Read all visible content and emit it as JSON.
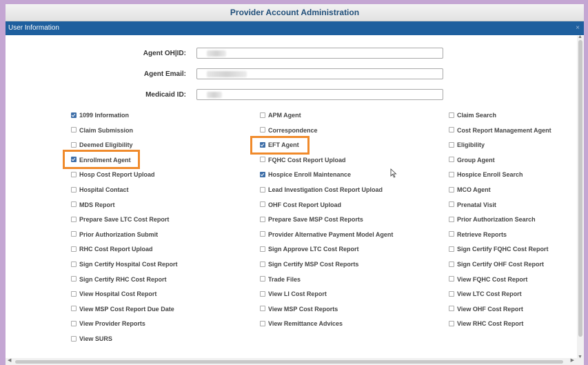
{
  "window": {
    "title": "Provider Account Administration"
  },
  "panel": {
    "title": "User Information",
    "close_glyph": "×"
  },
  "fields": [
    {
      "label": "Agent OH|ID:"
    },
    {
      "label": "Agent Email:"
    },
    {
      "label": "Medicaid ID:"
    }
  ],
  "permissions": {
    "col1": [
      {
        "label": "1099 Information",
        "checked": true
      },
      {
        "label": "Claim Submission",
        "checked": false
      },
      {
        "label": "Deemed Eligibility",
        "checked": false
      },
      {
        "label": "Enrollment Agent",
        "checked": true
      },
      {
        "label": "Hosp Cost Report Upload",
        "checked": false
      },
      {
        "label": "Hospital Contact",
        "checked": false
      },
      {
        "label": "MDS Report",
        "checked": false
      },
      {
        "label": "Prepare Save LTC Cost Report",
        "checked": false
      },
      {
        "label": "Prior Authorization Submit",
        "checked": false
      },
      {
        "label": "RHC Cost Report Upload",
        "checked": false
      },
      {
        "label": "Sign Certify Hospital Cost Report",
        "checked": false
      },
      {
        "label": "Sign Certify RHC Cost Report",
        "checked": false
      },
      {
        "label": "View Hospital Cost Report",
        "checked": false
      },
      {
        "label": "View MSP Cost Report Due Date",
        "checked": false
      },
      {
        "label": "View Provider Reports",
        "checked": false
      },
      {
        "label": "View SURS",
        "checked": false
      }
    ],
    "col2": [
      {
        "label": "APM Agent",
        "checked": false
      },
      {
        "label": "Correspondence",
        "checked": false
      },
      {
        "label": "EFT Agent",
        "checked": true
      },
      {
        "label": "FQHC Cost Report Upload",
        "checked": false
      },
      {
        "label": "Hospice Enroll Maintenance",
        "checked": true
      },
      {
        "label": "Lead Investigation Cost Report Upload",
        "checked": false
      },
      {
        "label": "OHF Cost Report Upload",
        "checked": false
      },
      {
        "label": "Prepare Save MSP Cost Reports",
        "checked": false
      },
      {
        "label": "Provider Alternative Payment Model Agent",
        "checked": false
      },
      {
        "label": "Sign Approve LTC Cost Report",
        "checked": false
      },
      {
        "label": "Sign Certify MSP Cost Reports",
        "checked": false
      },
      {
        "label": "Trade Files",
        "checked": false
      },
      {
        "label": "View LI Cost Report",
        "checked": false
      },
      {
        "label": "View MSP Cost Reports",
        "checked": false
      },
      {
        "label": "View Remittance Advices",
        "checked": false
      }
    ],
    "col3": [
      {
        "label": "Claim Search",
        "checked": false
      },
      {
        "label": "Cost Report Management Agent",
        "checked": false
      },
      {
        "label": "Eligibility",
        "checked": false
      },
      {
        "label": "Group Agent",
        "checked": false
      },
      {
        "label": "Hospice Enroll Search",
        "checked": false
      },
      {
        "label": "MCO Agent",
        "checked": false
      },
      {
        "label": "Prenatal Visit",
        "checked": false
      },
      {
        "label": "Prior Authorization Search",
        "checked": false
      },
      {
        "label": "Retrieve Reports",
        "checked": false
      },
      {
        "label": "Sign Certify FQHC Cost Report",
        "checked": false
      },
      {
        "label": "Sign Certify OHF Cost Report",
        "checked": false
      },
      {
        "label": "View FQHC Cost Report",
        "checked": false
      },
      {
        "label": "View LTC Cost Report",
        "checked": false
      },
      {
        "label": "View OHF Cost Report",
        "checked": false
      },
      {
        "label": "View RHC Cost Report",
        "checked": false
      }
    ]
  },
  "highlight_color": "#f08a2b",
  "accent_color": "#1e5f9e"
}
